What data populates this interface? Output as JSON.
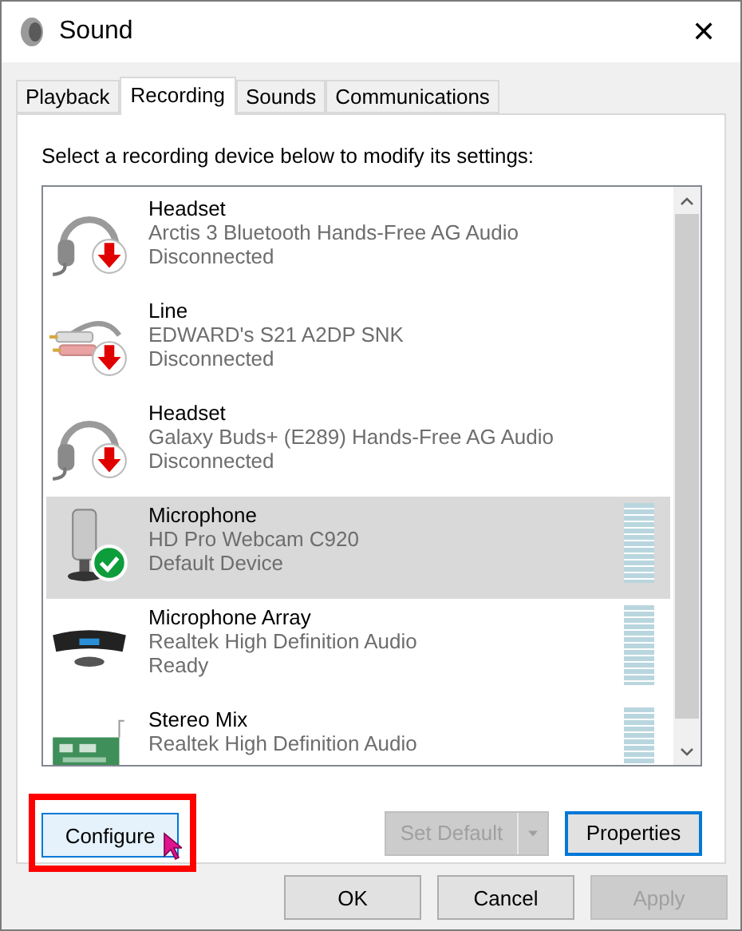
{
  "window": {
    "title": "Sound",
    "close": "✕"
  },
  "tabs": [
    {
      "label": "Playback",
      "selected": false
    },
    {
      "label": "Recording",
      "selected": true
    },
    {
      "label": "Sounds",
      "selected": false
    },
    {
      "label": "Communications",
      "selected": false
    }
  ],
  "instruction": "Select a recording device below to modify its settings:",
  "devices": [
    {
      "kind": "headset",
      "name": "Headset",
      "description": "Arctis 3 Bluetooth Hands-Free AG Audio",
      "status": "Disconnected",
      "disconnected": true,
      "default_device": false,
      "selected": false
    },
    {
      "kind": "line",
      "name": "Line",
      "description": "EDWARD's S21 A2DP SNK",
      "status": "Disconnected",
      "disconnected": true,
      "default_device": false,
      "selected": false
    },
    {
      "kind": "headset",
      "name": "Headset",
      "description": "Galaxy Buds+ (E289) Hands-Free AG Audio",
      "status": "Disconnected",
      "disconnected": true,
      "default_device": false,
      "selected": false
    },
    {
      "kind": "microphone",
      "name": "Microphone",
      "description": "HD Pro Webcam C920",
      "status": "Default Device",
      "disconnected": false,
      "default_device": true,
      "selected": true
    },
    {
      "kind": "array",
      "name": "Microphone Array",
      "description": "Realtek High Definition Audio",
      "status": "Ready",
      "disconnected": false,
      "default_device": false,
      "selected": false
    },
    {
      "kind": "board",
      "name": "Stereo Mix",
      "description": "Realtek High Definition Audio",
      "disconnected": false,
      "default_device": false,
      "selected": false
    }
  ],
  "device_buttons": [
    {
      "label": "Configure",
      "disabled": false,
      "highlighted": true,
      "is_default": false,
      "kind": "plain"
    },
    {
      "label": "Set Default",
      "disabled": true,
      "highlighted": false,
      "is_default": false,
      "kind": "split"
    },
    {
      "label": "Properties",
      "disabled": false,
      "highlighted": false,
      "is_default": true,
      "kind": "plain"
    }
  ],
  "dialog_buttons": [
    {
      "label": "OK",
      "disabled": false
    },
    {
      "label": "Cancel",
      "disabled": false
    },
    {
      "label": "Apply",
      "disabled": true
    }
  ]
}
